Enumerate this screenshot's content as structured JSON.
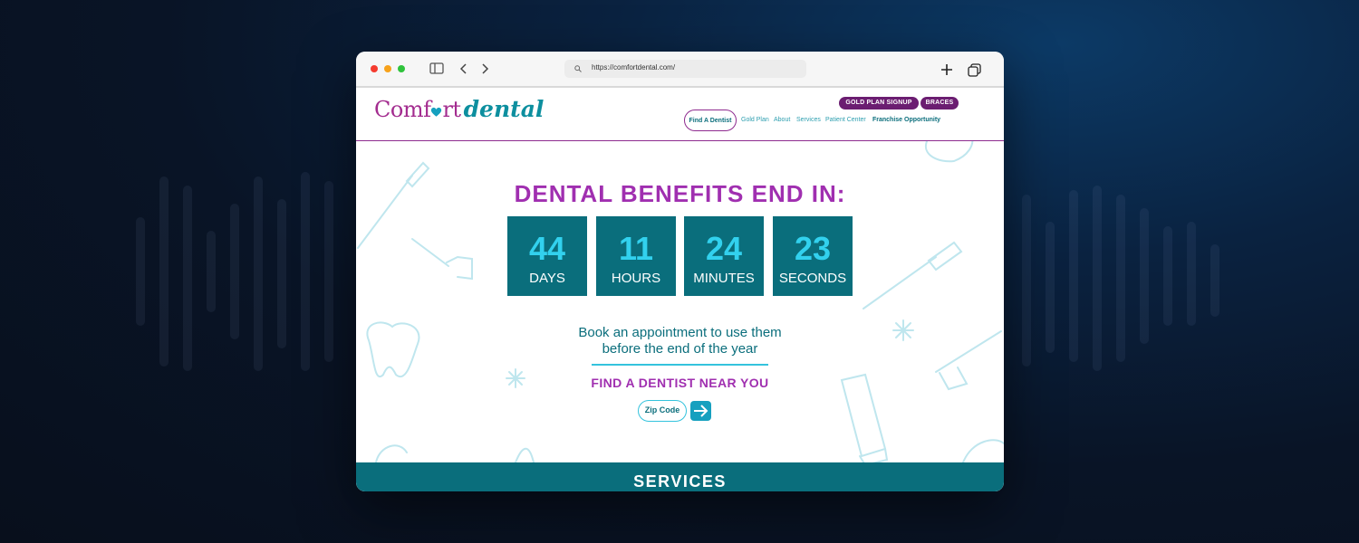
{
  "browser": {
    "url": "https://comfortdental.com/",
    "window_controls": [
      "close",
      "minimize",
      "zoom"
    ],
    "toolbar_icons": [
      "sidebar-icon",
      "back-icon",
      "forward-icon",
      "search-icon",
      "new-tab-icon",
      "tabs-overview-icon"
    ]
  },
  "site": {
    "logo": {
      "word1": "Comfort",
      "word2": "dental"
    },
    "top_buttons": {
      "gold_plan": "GOLD PLAN SIGNUP",
      "braces": "BRACES"
    },
    "nav": {
      "find_dentist": "Find A Dentist",
      "gold_plan": "Gold Plan",
      "about": "About",
      "services": "Services",
      "patient_center": "Patient Center",
      "franchise": "Franchise Opportunity"
    }
  },
  "hero": {
    "headline": "DENTAL BENEFITS END IN:",
    "countdown": {
      "days": {
        "value": "44",
        "label": "DAYS"
      },
      "hours": {
        "value": "11",
        "label": "HOURS"
      },
      "minutes": {
        "value": "24",
        "label": "MINUTES"
      },
      "seconds": {
        "value": "23",
        "label": "SECONDS"
      }
    },
    "book_line1": "Book an appointment to use them",
    "book_line2": "before the end of the year",
    "find_heading": "FIND A DENTIST NEAR YOU",
    "zip_placeholder": "Zip Code",
    "submit_icon": "arrow-right-icon"
  },
  "services": {
    "title": "SERVICES"
  },
  "colors": {
    "purple": "#a02fb0",
    "dark_purple": "#6b1d71",
    "teal": "#0a6e7c",
    "cyan": "#32d1ee"
  }
}
